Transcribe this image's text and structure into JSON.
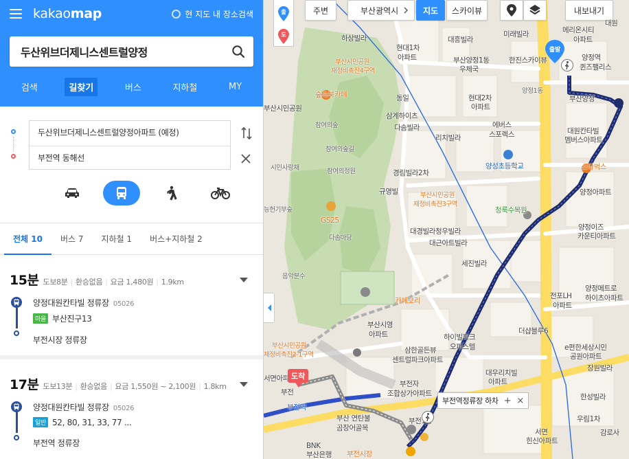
{
  "header": {
    "logo": "kakaomap",
    "search_in_map": "현 지도 내 장소검색",
    "query": "두산위브더제니스센트럴양정"
  },
  "nav_tabs": [
    {
      "label": "검색"
    },
    {
      "label": "길찾기"
    },
    {
      "label": "버스"
    },
    {
      "label": "지하철"
    },
    {
      "label": "MY"
    }
  ],
  "route": {
    "origin": "두산위브더제니스센트럴양정아파트 (예정)",
    "destination": "부전역 동해선"
  },
  "transport_modes": [
    "car-icon",
    "bus-icon",
    "walk-icon",
    "bike-icon"
  ],
  "filter_tabs": [
    "전체 10",
    "버스 7",
    "지하철 1",
    "버스+지하철 2"
  ],
  "results": [
    {
      "time": "15분",
      "walk": "도보8분",
      "transfer": "환승없음",
      "fare": "요금 1,480원",
      "distance": "1.9km",
      "stop": "양정대원칸타빌 정류장",
      "stop_id": "05026",
      "bus_type": "마을",
      "bus_lines": "부산진구13",
      "dest": "부전시장 정류장"
    },
    {
      "time": "17분",
      "walk": "도보13분",
      "transfer": "환승없음",
      "fare": "요금 1,550원 ~ 2,100원",
      "distance": "1.8km",
      "stop": "양정대원칸타빌 정류장",
      "stop_id": "05026",
      "bus_type": "일반",
      "bus_lines": "52, 80, 31, 33, 77 ...",
      "dest": "부전역 정류장"
    }
  ],
  "map_controls": {
    "start_mini": "출",
    "end_mini": "도",
    "nearby": "주변",
    "region": "부산광역시",
    "map": "지도",
    "skyview": "스카이뷰",
    "export": "내보내기"
  },
  "map_labels": [
    "하상빌라",
    "현대1차",
    "아파트",
    "대흥빌라",
    "미래빌라",
    "메리온시티",
    "아파트",
    "대원",
    "부산시민공원",
    "재정비촉진4구역",
    "부산양정1동",
    "우체국",
    "한진스카이뷰",
    "양정역",
    "퀸즈팰리스",
    "숲속북카페",
    "동일",
    "현대2차",
    "아파트",
    "양정1동",
    "부산시민공원",
    "부산양정",
    "삼계하이츠",
    "다솜빌라",
    "에버스",
    "스포렉스",
    "대원칸타빌",
    "멤버스아파트",
    "참여의숲",
    "리치빌라",
    "참여의숲길",
    "시민사랑채",
    "참여의정원",
    "양성초등학교",
    "스타벅스",
    "경림빌라2차",
    "규영빌",
    "부산시민공원",
    "재정비촉진3구역",
    "양정아파트",
    "능헌기부숲",
    "GS25",
    "청룩수목원",
    "양정이즈",
    "다솜마당",
    "대경빌라",
    "청우빌라",
    "카운티아파트",
    "대근아트빌라",
    "세진빌라",
    "음악분수",
    "양정메트로",
    "하이츠아파트",
    "전포LH",
    "아파트",
    "카페보리",
    "부산시영",
    "아파트",
    "삼한골든뷰",
    "센트럴파크아파트",
    "하이빌파크",
    "오피스텔",
    "더샵블루6",
    "e편한세상시민",
    "공원아파트",
    "장원빌라",
    "서면아파트",
    "부산시민공원",
    "재정비촉진2-1구역",
    "부전자",
    "조합상가아파트",
    "대우리치빌",
    "아파트",
    "한성빌라",
    "부산 연탄불",
    "곰장어골목",
    "부전1동",
    "우림1차",
    "감로사",
    "BNK",
    "부산은행",
    "서면",
    "힌신아파트",
    "부전시장",
    "부전역",
    "부전"
  ],
  "tooltip": {
    "label": "부전역정류장 하차",
    "plus": "+",
    "close": "×"
  },
  "pins": {
    "start": "출발",
    "end": "도착"
  }
}
